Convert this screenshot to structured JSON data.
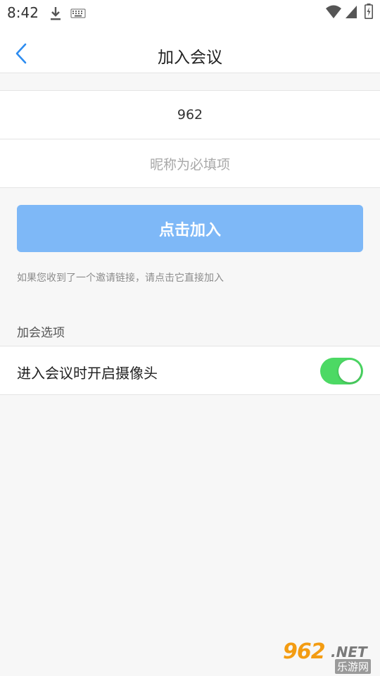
{
  "status_bar": {
    "time": "8:42",
    "icons": [
      "download-icon",
      "keyboard-icon",
      "wifi-icon",
      "signal-icon",
      "battery-charging-icon"
    ]
  },
  "nav": {
    "title": "加入会议",
    "back_icon": "chevron-left-icon"
  },
  "form": {
    "meeting_id": "962",
    "nickname_placeholder": "昵称为必填项"
  },
  "join_button": {
    "label": "点击加入",
    "color": "#7eb8f7"
  },
  "hint": "如果您收到了一个邀请链接，请点击它直接加入",
  "options": {
    "header": "加会选项",
    "items": [
      {
        "label": "进入会议时开启摄像头",
        "enabled": true
      }
    ]
  },
  "colors": {
    "accent": "#2d8cf0",
    "toggle_on": "#4cd964",
    "background": "#f7f7f7"
  },
  "watermark": {
    "number": "962",
    "domain": ".NET",
    "name": "乐游网"
  }
}
